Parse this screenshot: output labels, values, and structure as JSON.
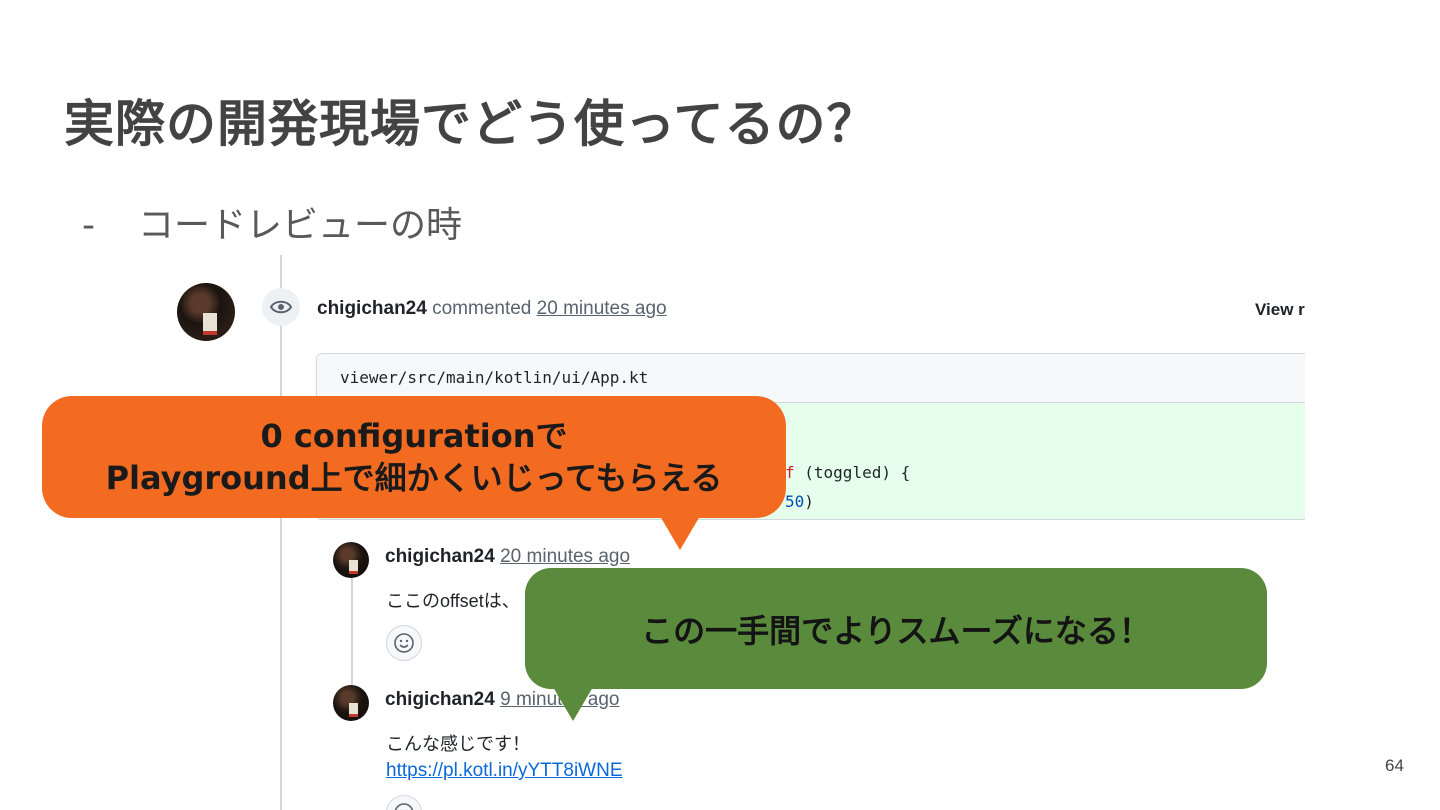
{
  "slide": {
    "title": "実際の開発現場でどう使ってるの？",
    "bullet_marker": "-",
    "bullet_text": "コードレビューの時",
    "page_number": "64"
  },
  "review": {
    "main_comment": {
      "author": "chigichan24",
      "action": "commented",
      "time": "20 minutes ago",
      "view_link": "View r"
    },
    "file": {
      "path": "viewer/src/main/kotlin/ui/App.kt",
      "diff_lines": [
        {
          "prefix": "f",
          "rest": " (toggled) {"
        },
        {
          "prefix": "50",
          "rest": ")"
        }
      ]
    },
    "replies": [
      {
        "author": "chigichan24",
        "time": "20 minutes ago",
        "body": "ここのoffsetは、",
        "link": ""
      },
      {
        "author": "chigichan24",
        "time": "9 minutes ago",
        "body": "こんな感じです！",
        "link": "https://pl.kotl.in/yYTT8iWNE"
      }
    ]
  },
  "callouts": {
    "orange_line1": "0 configurationで",
    "orange_line2": "Playground上で細かくいじってもらえる",
    "green": "この一手間でよりスムーズになる！",
    "orange_color": "#f26b21",
    "green_color": "#5a8a3c"
  },
  "icons": [
    "eye-icon",
    "smiley-icon"
  ]
}
